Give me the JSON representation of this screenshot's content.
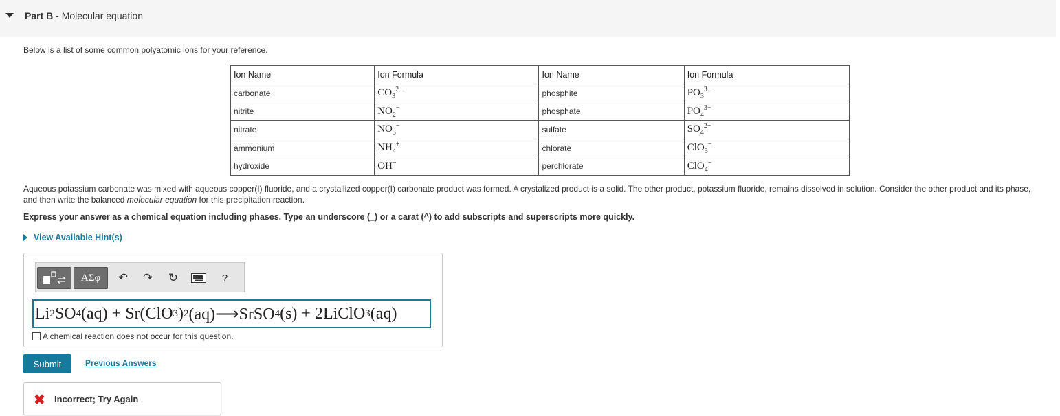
{
  "part": {
    "label": "Part B",
    "separator": " - ",
    "title": "Molecular equation"
  },
  "intro": "Below is a list of some common polyatomic ions for your reference.",
  "table": {
    "headers": [
      "Ion Name",
      "Ion Formula",
      "Ion Name",
      "Ion Formula"
    ],
    "rows": [
      {
        "name1": "carbonate",
        "f1_base": "CO",
        "f1_sub": "3",
        "f1_sup": "2−",
        "name2": "phosphite",
        "f2_base": "PO",
        "f2_sub": "3",
        "f2_sup": "3−"
      },
      {
        "name1": "nitrite",
        "f1_base": "NO",
        "f1_sub": "2",
        "f1_sup": "−",
        "name2": "phosphate",
        "f2_base": "PO",
        "f2_sub": "4",
        "f2_sup": "3−"
      },
      {
        "name1": "nitrate",
        "f1_base": "NO",
        "f1_sub": "3",
        "f1_sup": "−",
        "name2": "sulfate",
        "f2_base": "SO",
        "f2_sub": "4",
        "f2_sup": "2−"
      },
      {
        "name1": "ammonium",
        "f1_base": "NH",
        "f1_sub": "4",
        "f1_sup": "+",
        "name2": "chlorate",
        "f2_base": "ClO",
        "f2_sub": "3",
        "f2_sup": "−"
      },
      {
        "name1": "hydroxide",
        "f1_base": "OH",
        "f1_sub": "",
        "f1_sup": "−",
        "name2": "perchlorate",
        "f2_base": "ClO",
        "f2_sub": "4",
        "f2_sup": "−"
      }
    ]
  },
  "description": {
    "before": "Aqueous potassium carbonate was mixed with aqueous copper(I) fluoride, and a crystallized copper(I) carbonate product was formed. A crystalized product is a solid. The other product, potassium fluoride, remains dissolved in solution. Consider the other product and its phase, and then write the balanced ",
    "emphasis": "molecular equation",
    "after": " for this precipitation reaction."
  },
  "instruction": "Express your answer as a chemical equation including phases. Type an underscore (_) or a carat (^) to add subscripts and superscripts more quickly.",
  "hint_label": "View Available Hint(s)",
  "toolbar": {
    "greek_label": "ΑΣφ",
    "undo_icon": "↶",
    "redo_icon": "↷",
    "reset_icon": "↻",
    "help_label": "?"
  },
  "answer": {
    "t1": "Li",
    "s1": "2",
    "t2": " SO",
    "s2": "4",
    "t3": " (aq) + Sr(ClO",
    "s3": "3",
    "t4": " )",
    "s4": "2",
    "t5": " (aq)⟶SrSO",
    "s5": "4",
    "t6": " (s) + 2LiClO",
    "s6": "3",
    "t7": " (aq)"
  },
  "no_reaction_label": "A chemical reaction does not occur for this question.",
  "submit_label": "Submit",
  "previous_answers_label": "Previous Answers",
  "feedback": {
    "icon": "✖",
    "text": "Incorrect; Try Again",
    "color": "#d22020"
  },
  "colors": {
    "accent": "#157a9c",
    "link": "#1a7a9a",
    "header_bg": "#f5f5f5"
  }
}
